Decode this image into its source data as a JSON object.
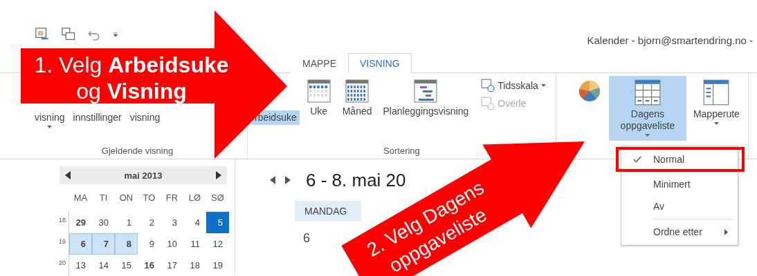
{
  "window": {
    "title": "Kalender - bjorn@smartendring.no -"
  },
  "tabs": [
    {
      "label": "MAPPE",
      "selected": false
    },
    {
      "label": "VISNING",
      "selected": true
    }
  ],
  "ribbon": {
    "groups": [
      {
        "label": "Gjeldende visning",
        "buttons": [
          {
            "kind": "text",
            "label": "visning",
            "dropdown": true,
            "selected": false
          },
          {
            "kind": "text",
            "label": "innstillinger",
            "dropdown": false,
            "selected": false
          },
          {
            "kind": "text",
            "label": "visning",
            "dropdown": false,
            "selected": false
          }
        ]
      },
      {
        "label": "Sortering",
        "buttons": [
          {
            "kind": "text",
            "label": "rbeidsuke",
            "dropdown": false,
            "selected": true
          },
          {
            "kind": "week",
            "label": "Uke",
            "dropdown": false,
            "selected": false
          },
          {
            "kind": "month",
            "label": "Måned",
            "dropdown": false,
            "selected": false
          },
          {
            "kind": "schedule",
            "label": "Planleggingsvisning",
            "dropdown": false,
            "selected": false
          }
        ],
        "small_items": [
          {
            "label": "Tidsskala",
            "dropdown": true,
            "disabled": false
          },
          {
            "label": "Overle",
            "dropdown": false,
            "disabled": true
          }
        ]
      },
      {
        "buttons": [
          {
            "kind": "pie",
            "dropdown": false,
            "selected": false
          },
          {
            "kind": "todo",
            "label": "Dagens oppgaveliste",
            "dropdown": true,
            "selected": true
          },
          {
            "kind": "folder",
            "label": "Mapperute",
            "dropdown": true,
            "selected": false
          }
        ]
      }
    ]
  },
  "menu": {
    "items": [
      {
        "label": "Normal",
        "checked": true,
        "highlighted": true,
        "submenu": false
      },
      {
        "label": "Minimert",
        "checked": false,
        "highlighted": false,
        "submenu": false
      },
      {
        "label": "Av",
        "checked": false,
        "highlighted": false,
        "submenu": false
      },
      {
        "label": "Ordne etter",
        "checked": false,
        "highlighted": false,
        "submenu": true
      }
    ]
  },
  "mini_calendar": {
    "month": "mai 2013",
    "weekdays": [
      "MA",
      "TI",
      "ON",
      "TO",
      "FR",
      "LØ",
      "SØ"
    ],
    "weeks": [
      {
        "number": "18",
        "days": [
          {
            "label": "29",
            "bold": true,
            "selected": false,
            "today": false
          },
          {
            "label": "30",
            "bold": false,
            "selected": false,
            "today": false
          },
          {
            "label": "1",
            "bold": false,
            "selected": false,
            "today": false
          },
          {
            "label": "2",
            "bold": false,
            "selected": false,
            "today": false
          },
          {
            "label": "3",
            "bold": false,
            "selected": false,
            "today": false
          },
          {
            "label": "4",
            "bold": false,
            "selected": false,
            "today": false
          },
          {
            "label": "5",
            "bold": false,
            "selected": false,
            "today": true
          }
        ]
      },
      {
        "number": "19",
        "days": [
          {
            "label": "6",
            "bold": true,
            "selected": true,
            "today": false
          },
          {
            "label": "7",
            "bold": true,
            "selected": true,
            "today": false
          },
          {
            "label": "8",
            "bold": true,
            "selected": true,
            "today": false
          },
          {
            "label": "9",
            "bold": false,
            "selected": false,
            "today": false
          },
          {
            "label": "10",
            "bold": false,
            "selected": false,
            "today": false
          },
          {
            "label": "11",
            "bold": false,
            "selected": false,
            "today": false
          },
          {
            "label": "12",
            "bold": false,
            "selected": false,
            "today": false
          }
        ]
      },
      {
        "number": "20",
        "days": [
          {
            "label": "13",
            "bold": false,
            "selected": false,
            "today": false
          },
          {
            "label": "14",
            "bold": false,
            "selected": false,
            "today": false
          },
          {
            "label": "15",
            "bold": false,
            "selected": false,
            "today": false
          },
          {
            "label": "16",
            "bold": true,
            "selected": false,
            "today": false
          },
          {
            "label": "17",
            "bold": false,
            "selected": false,
            "today": false
          },
          {
            "label": "18",
            "bold": false,
            "selected": false,
            "today": false
          },
          {
            "label": "19",
            "bold": false,
            "selected": false,
            "today": false
          }
        ]
      }
    ]
  },
  "calendar": {
    "range": "6 - 8. mai 20",
    "columns": [
      {
        "weekday": "MANDAG",
        "date": "6"
      }
    ]
  },
  "callouts": [
    {
      "lines": [
        "1. Velg **Arbeidsuke**",
        "og **Visning**"
      ]
    },
    {
      "lines": [
        "2. Velg Dagens",
        "oppgaveliste"
      ]
    }
  ]
}
